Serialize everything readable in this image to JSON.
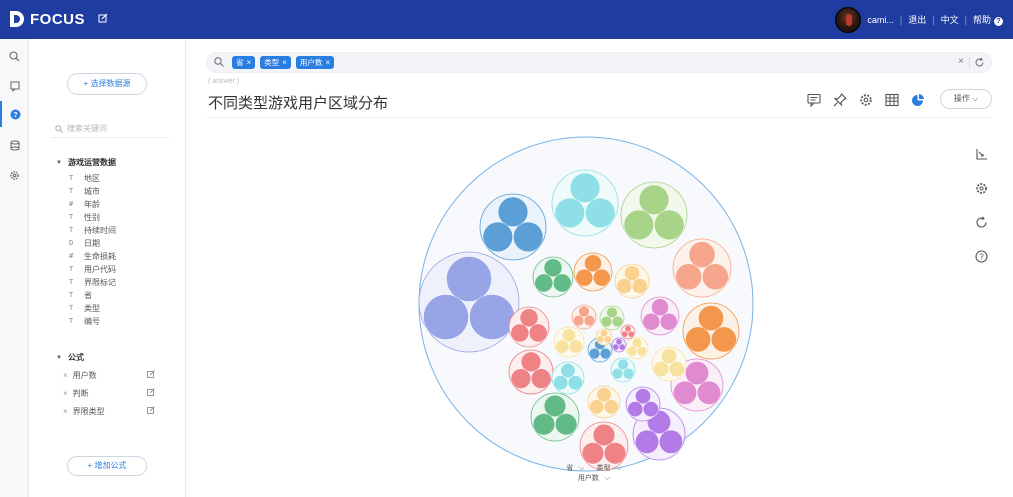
{
  "app": {
    "logo_text": "FOCUS"
  },
  "topbar": {
    "username": "cami...",
    "logout": "退出",
    "language": "中文",
    "help": "帮助"
  },
  "panel": {
    "choose_source": "+ 选择数据源",
    "search_placeholder": "搜索关键词",
    "group1": {
      "title": "游戏运营数据",
      "fields": [
        {
          "icon": "T",
          "label": "地区"
        },
        {
          "icon": "T",
          "label": "城市"
        },
        {
          "icon": "#",
          "label": "年龄"
        },
        {
          "icon": "T",
          "label": "性别"
        },
        {
          "icon": "T",
          "label": "持续时间"
        },
        {
          "icon": "D",
          "label": "日期"
        },
        {
          "icon": "#",
          "label": "生命损耗"
        },
        {
          "icon": "T",
          "label": "用户代码"
        },
        {
          "icon": "T",
          "label": "界限标记"
        },
        {
          "icon": "T",
          "label": "省"
        },
        {
          "icon": "T",
          "label": "类型"
        },
        {
          "icon": "T",
          "label": "编号"
        }
      ]
    },
    "group2": {
      "title": "公式",
      "formulas": [
        "用户数",
        "判断",
        "界限类型"
      ]
    },
    "add_formula": "+ 增加公式"
  },
  "search": {
    "tags": [
      "省",
      "类型",
      "用户数"
    ]
  },
  "main": {
    "subtitle": "( answer )",
    "title": "不同类型游戏用户区域分布",
    "operate": "操作",
    "dims": {
      "d1": "省",
      "d2": "类型",
      "d3": "用户数"
    }
  },
  "colors": {
    "topbar": "#1f3ca0",
    "accent": "#2a7de1",
    "outer_circle_stroke": "#7ab3e6"
  },
  "icons": [
    "search-icon",
    "bookmark-icon",
    "help-icon",
    "database-icon",
    "gear-icon",
    "comment-icon",
    "pin-icon",
    "table-icon",
    "pie-icon",
    "axis-icon",
    "refresh-icon",
    "question-icon"
  ],
  "chart_data": {
    "type": "circle-packing",
    "hierarchy": [
      "省",
      "类型",
      "用户数"
    ]
  }
}
